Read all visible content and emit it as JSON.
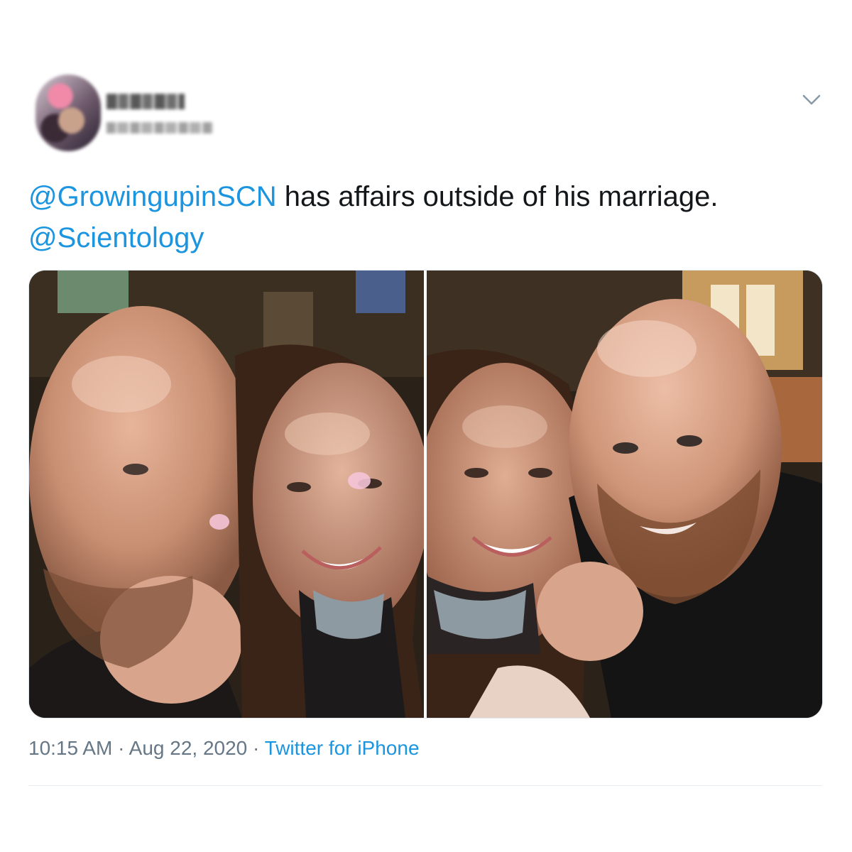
{
  "tweet": {
    "text": {
      "mention1": "@GrowingupinSCN",
      "body": " has affairs outside of his marriage.",
      "mention2": "@Scientology"
    },
    "time": "10:15 AM",
    "separator": "·",
    "date": "Aug 22, 2020",
    "source": "Twitter for iPhone"
  },
  "icons": {
    "menu": "chevron-down-icon"
  },
  "colors": {
    "link": "#1b95e0",
    "meta": "#657786",
    "text": "#14171a"
  }
}
